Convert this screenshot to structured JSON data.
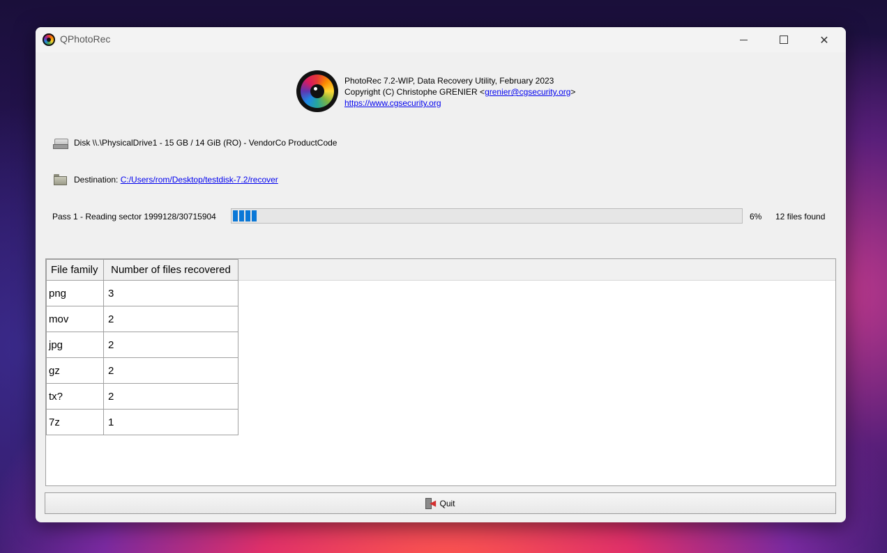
{
  "window": {
    "title": "QPhotoRec"
  },
  "header": {
    "line1": "PhotoRec 7.2-WIP, Data Recovery Utility, February 2023",
    "copyright_prefix": "Copyright (C) Christophe GRENIER <",
    "email": "grenier@cgsecurity.org",
    "copyright_suffix": ">",
    "website": "https://www.cgsecurity.org"
  },
  "disk": {
    "label": "Disk \\\\.\\PhysicalDrive1 - 15 GB / 14 GiB (RO) - VendorCo ProductCode"
  },
  "destination": {
    "label": "Destination:",
    "path": "C:/Users/rom/Desktop/testdisk-7.2/recover"
  },
  "progress": {
    "status": "Pass 1 - Reading sector 1999128/30715904",
    "percent_label": "6%",
    "fraction": 0.05,
    "files_found": "12 files found"
  },
  "table": {
    "headers": [
      "File family",
      "Number of files recovered"
    ],
    "rows": [
      [
        "png",
        "3"
      ],
      [
        "mov",
        "2"
      ],
      [
        "jpg",
        "2"
      ],
      [
        "gz",
        "2"
      ],
      [
        "tx?",
        "2"
      ],
      [
        "7z",
        "1"
      ]
    ]
  },
  "quit": {
    "label": "Quit"
  },
  "icons": {
    "app": "photorec-icon",
    "disk": "disk-icon",
    "folder": "folder-icon",
    "quit": "quit-icon"
  },
  "colors": {
    "progress_fill": "#0a78d7",
    "link": "#0000ee"
  }
}
